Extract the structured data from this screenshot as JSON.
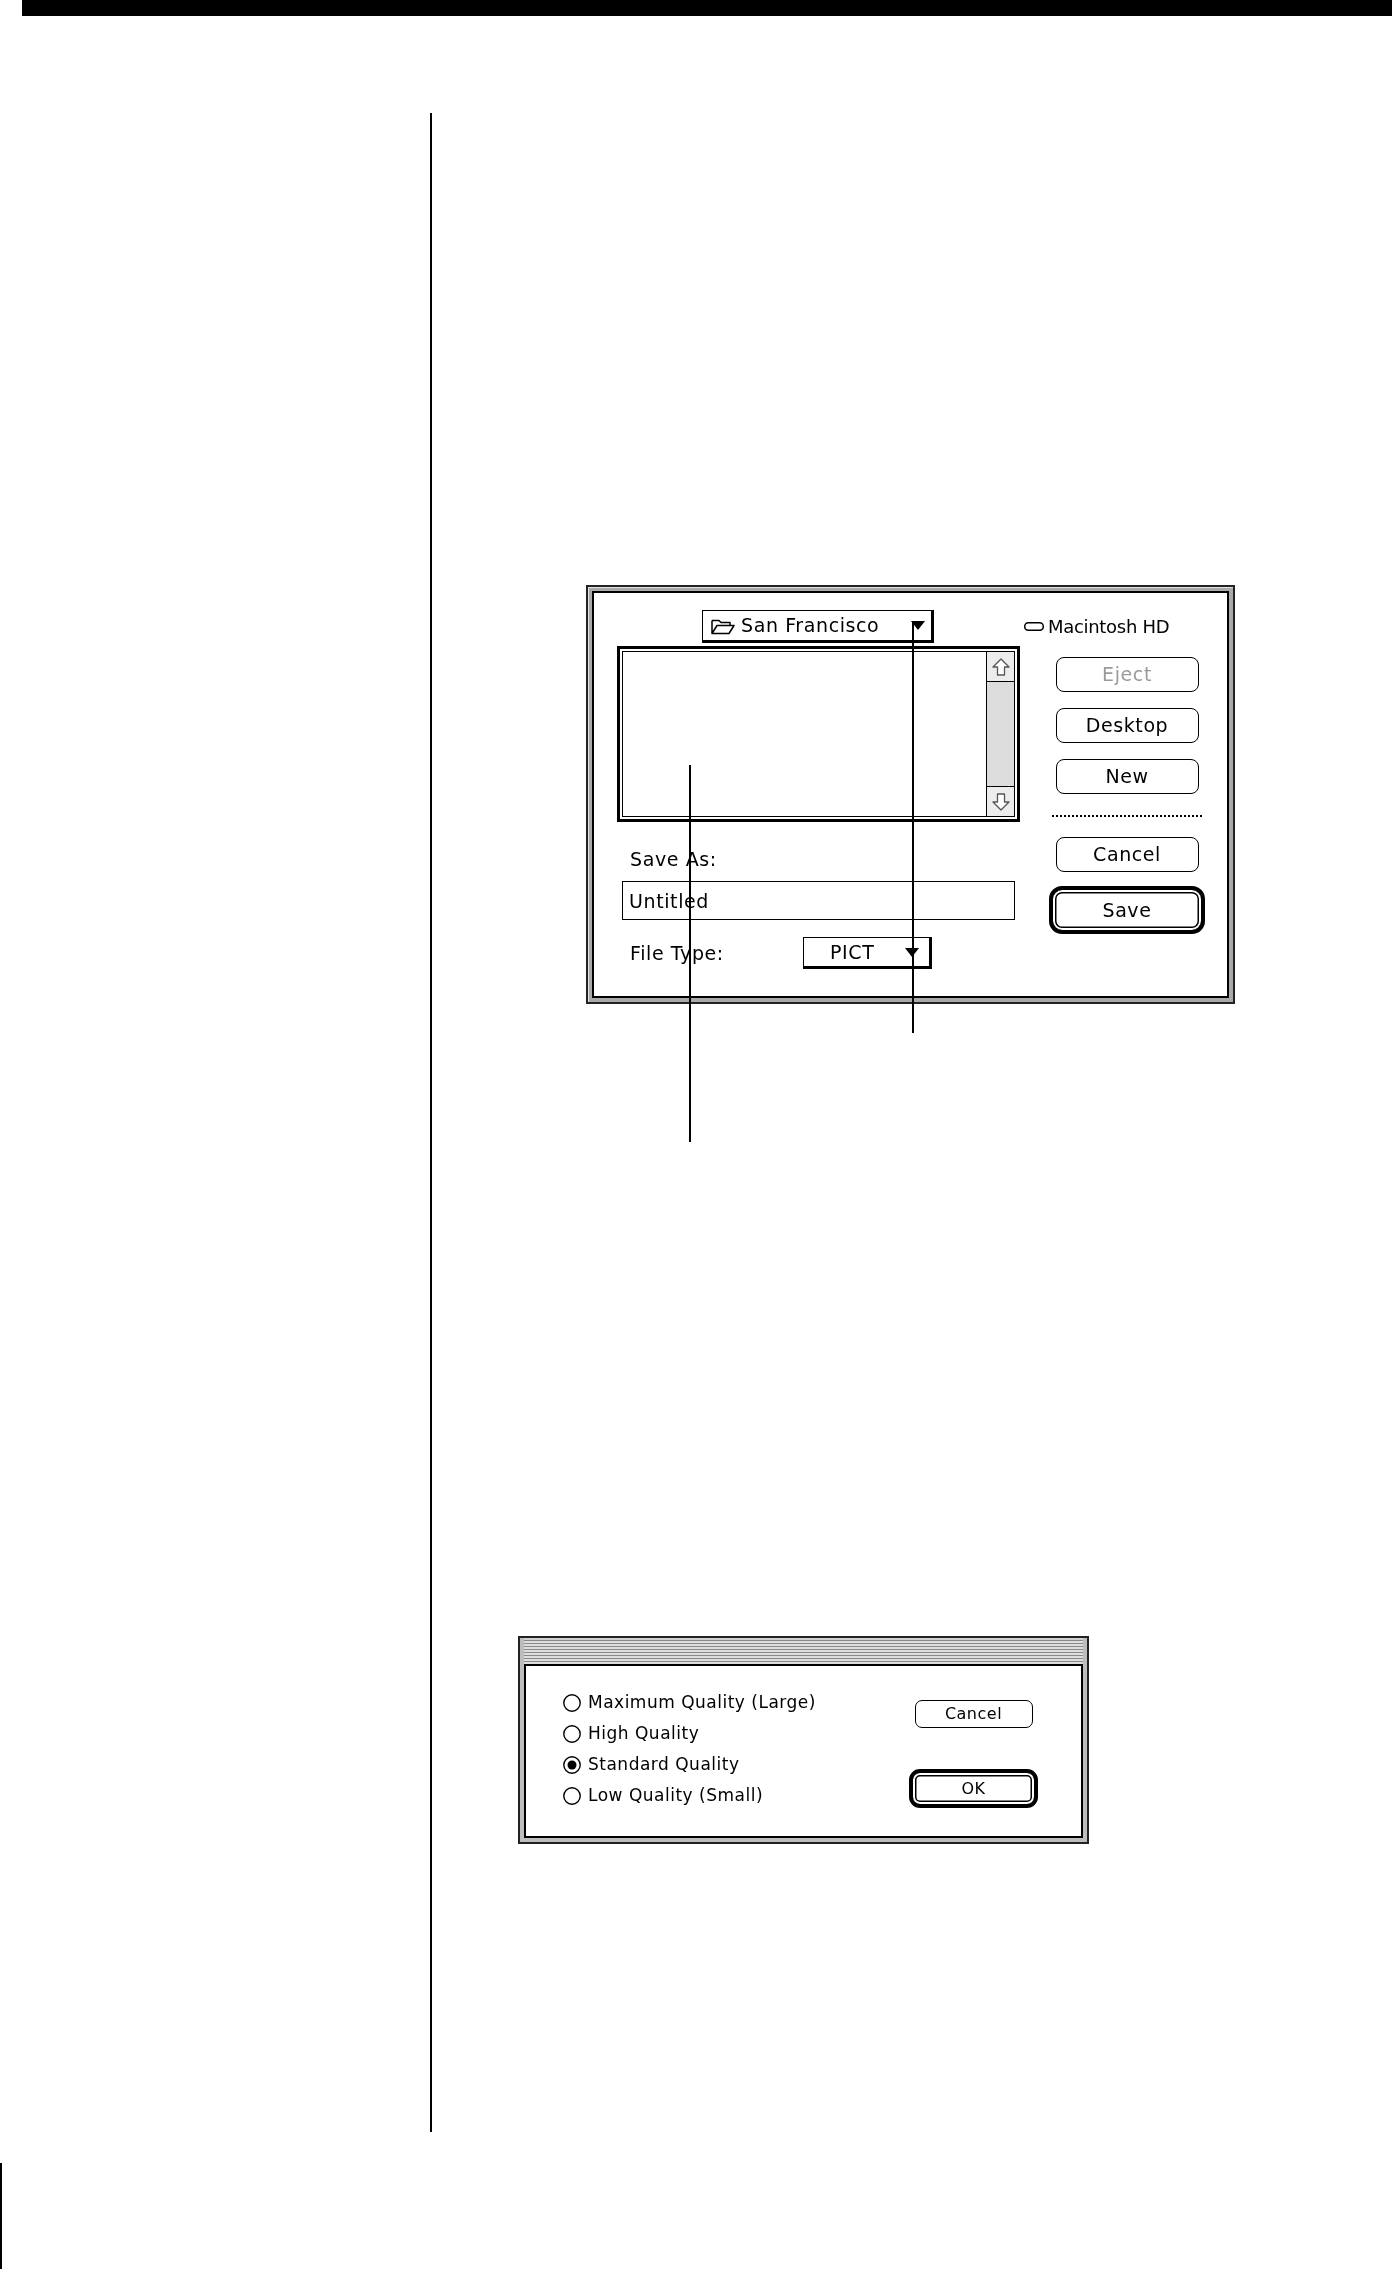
{
  "save_dialog": {
    "folder_popup": {
      "label": "San Francisco"
    },
    "disk": {
      "label": "Macintosh HD"
    },
    "volume_buttons": [
      {
        "label": "Eject",
        "disabled": true,
        "default": false
      },
      {
        "label": "Desktop",
        "disabled": false,
        "default": false
      },
      {
        "label": "New",
        "disabled": false,
        "default": false
      }
    ],
    "action_buttons": [
      {
        "label": "Cancel",
        "disabled": false,
        "default": false
      },
      {
        "label": "Save",
        "disabled": false,
        "default": true
      }
    ],
    "save_as": {
      "label": "Save As:",
      "value": "Untitled"
    },
    "file_type": {
      "label": "File Type:",
      "value": "PICT"
    }
  },
  "quality_dialog": {
    "options": [
      {
        "label": "Maximum Quality (Large)",
        "selected": false
      },
      {
        "label": "High Quality",
        "selected": false
      },
      {
        "label": "Standard Quality",
        "selected": true
      },
      {
        "label": "Low Quality (Small)",
        "selected": false
      }
    ],
    "buttons": [
      {
        "label": "Cancel",
        "default": false
      },
      {
        "label": "OK",
        "default": true
      }
    ]
  }
}
